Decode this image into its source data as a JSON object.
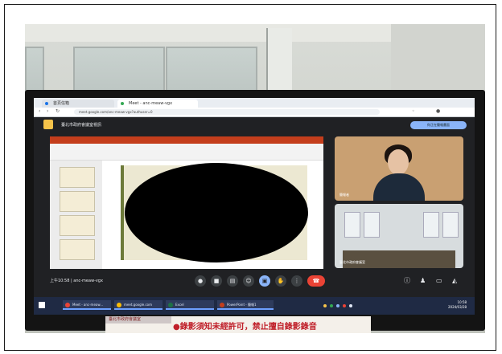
{
  "browser": {
    "tabs": [
      {
        "label": "首頁信箱"
      },
      {
        "label": "Meet - anc-meaw-vgx"
      }
    ],
    "url": "meet.google.com/anc-meaw-vgx?authuser=0"
  },
  "meet": {
    "header_title": "臺北市政府會議室視訊",
    "present_button": "你正在簡報畫面",
    "tile1_label": "簡報者",
    "tile2_label": "臺北市政府會議室",
    "time_and_code": "上午10:58 | anc-meaw-vgx"
  },
  "taskbar": {
    "items": [
      {
        "label": "Meet - anc-meaw..."
      },
      {
        "label": "meet.google.com"
      },
      {
        "label": "Excel"
      },
      {
        "label": "PowerPoint - 簡報1"
      }
    ],
    "time": "10:58",
    "date": "2024/03/28"
  },
  "sign": {
    "tag": "臺北市政府會議室",
    "text": "●錄影須知未經許可，禁止擅自錄影錄音"
  },
  "colors": {
    "meet_bg": "#202124",
    "hangup": "#ea4335",
    "accent_blue": "#8ab4f8",
    "ppt_red": "#c43e1c",
    "sign_red": "#c0202a"
  }
}
